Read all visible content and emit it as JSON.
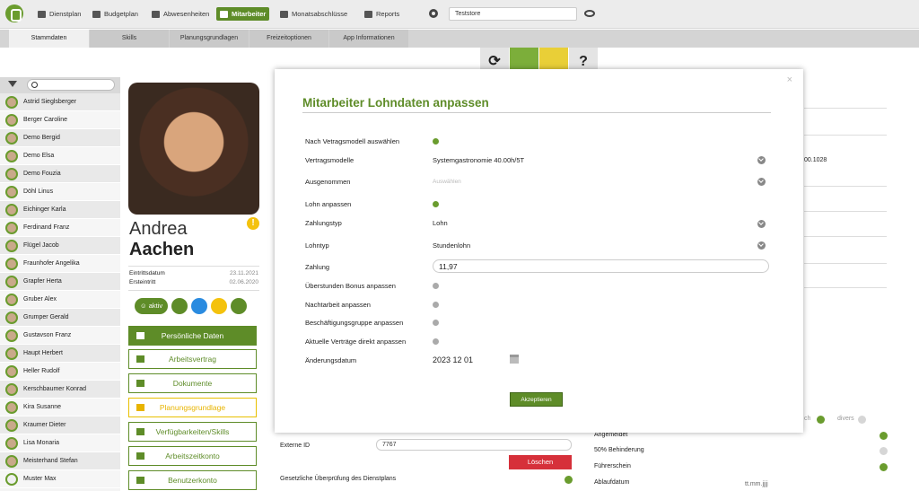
{
  "topnav": {
    "items": [
      {
        "label": "Dienstplan",
        "icon": "calendar-icon"
      },
      {
        "label": "Budgetplan",
        "icon": "chart-icon"
      },
      {
        "label": "Abwesenheiten",
        "icon": "umbrella-icon"
      },
      {
        "label": "Mitarbeiter",
        "icon": "users-icon",
        "active": true
      },
      {
        "label": "Monatsabschlüsse",
        "icon": "document-icon"
      },
      {
        "label": "Reports",
        "icon": "report-icon"
      }
    ],
    "store_select": "Teststore"
  },
  "tabs": [
    "Stammdaten",
    "Skills",
    "Planungsgrundlagen",
    "Freizeitoptionen",
    "App Informationen"
  ],
  "toolbar": {
    "refresh_glyph": "⟳",
    "help_glyph": "?"
  },
  "employees": [
    "Astrid Sieglsberger",
    "Berger Caroline",
    "Demo Bergid",
    "Demo Elsa",
    "Demo Fouzia",
    "Döhl Linus",
    "Eichinger Karla",
    "Ferdinand Franz",
    "Flügel Jacob",
    "Fraunhofer Angelika",
    "Grapfer Herta",
    "Gruber Alex",
    "Grumper Gerald",
    "Gustavson Franz",
    "Haupt Herbert",
    "Heller Rudolf",
    "Kerschbaumer Konrad",
    "Kira Susanne",
    "Kraumer Dieter",
    "Lisa Monaria",
    "Meisterhand Stefan",
    "Muster Max"
  ],
  "profile": {
    "first_name": "Andrea",
    "last_name": "Aachen",
    "warning_glyph": "!",
    "eintritt_label": "Eintrittsdatum",
    "eintritt_value": "23.11.2021",
    "ersteintritt_label": "Ersteintritt",
    "ersteintritt_value": "02.06.2020",
    "status_label": "aktiv"
  },
  "profile_menu": [
    "Persönliche Daten",
    "Arbeitsvertrag",
    "Dokumente",
    "Planungsgrundlage",
    "Verfügbarkeiten/Skills",
    "Arbeitszeitkonto",
    "Benutzerkonto"
  ],
  "background_form": {
    "externe_id_label": "Externe ID",
    "externe_id_value": "7767",
    "delete_label": "Löschen",
    "pruefung_label": "Gesetzliche Überprüfung des Dienstplans",
    "angemeldet_label": "Angemeldet",
    "behinderung_label": "50% Behinderung",
    "fuehrerschein_label": "Führerschein",
    "ablaufdatum_label": "Ablaufdatum",
    "ablaufdatum_placeholder": "tt.mm.jjjj",
    "divers_label": "divers",
    "partial_ch": "ch",
    "partial_id": "00.1028"
  },
  "modal": {
    "title": "Mitarbeiter Lohndaten anpassen",
    "close_glyph": "×",
    "rows": {
      "vertragsmodell_waehlen": "Nach Vetragsmodell auswählen",
      "vertragsmodelle_label": "Vertragsmodelle",
      "vertragsmodelle_value": "Systemgastronomie 40.00h/5T",
      "ausgenommen_label": "Ausgenommen",
      "ausgenommen_value": "Auswählen",
      "lohn_anpassen": "Lohn anpassen",
      "zahlungstyp_label": "Zahlungstyp",
      "zahlungstyp_value": "Lohn",
      "lohntyp_label": "Lohntyp",
      "lohntyp_value": "Stundenlohn",
      "zahlung_label": "Zahlung",
      "zahlung_value": "11,97",
      "ueberstunden_label": "Überstunden Bonus anpassen",
      "nachtarbeit_label": "Nachtarbeit anpassen",
      "beschaeftigung_label": "Beschäftigungsgruppe anpassen",
      "vertraege_label": "Aktuelle Verträge direkt anpassen",
      "aenderungsdatum_label": "Änderungsdatum",
      "aenderungsdatum_value": "2023 12 01"
    },
    "accept_label": "Akzeptieren"
  },
  "colors": {
    "brand_green": "#5e8c28",
    "warning_yellow": "#f4c20d",
    "danger_red": "#d6303a"
  }
}
